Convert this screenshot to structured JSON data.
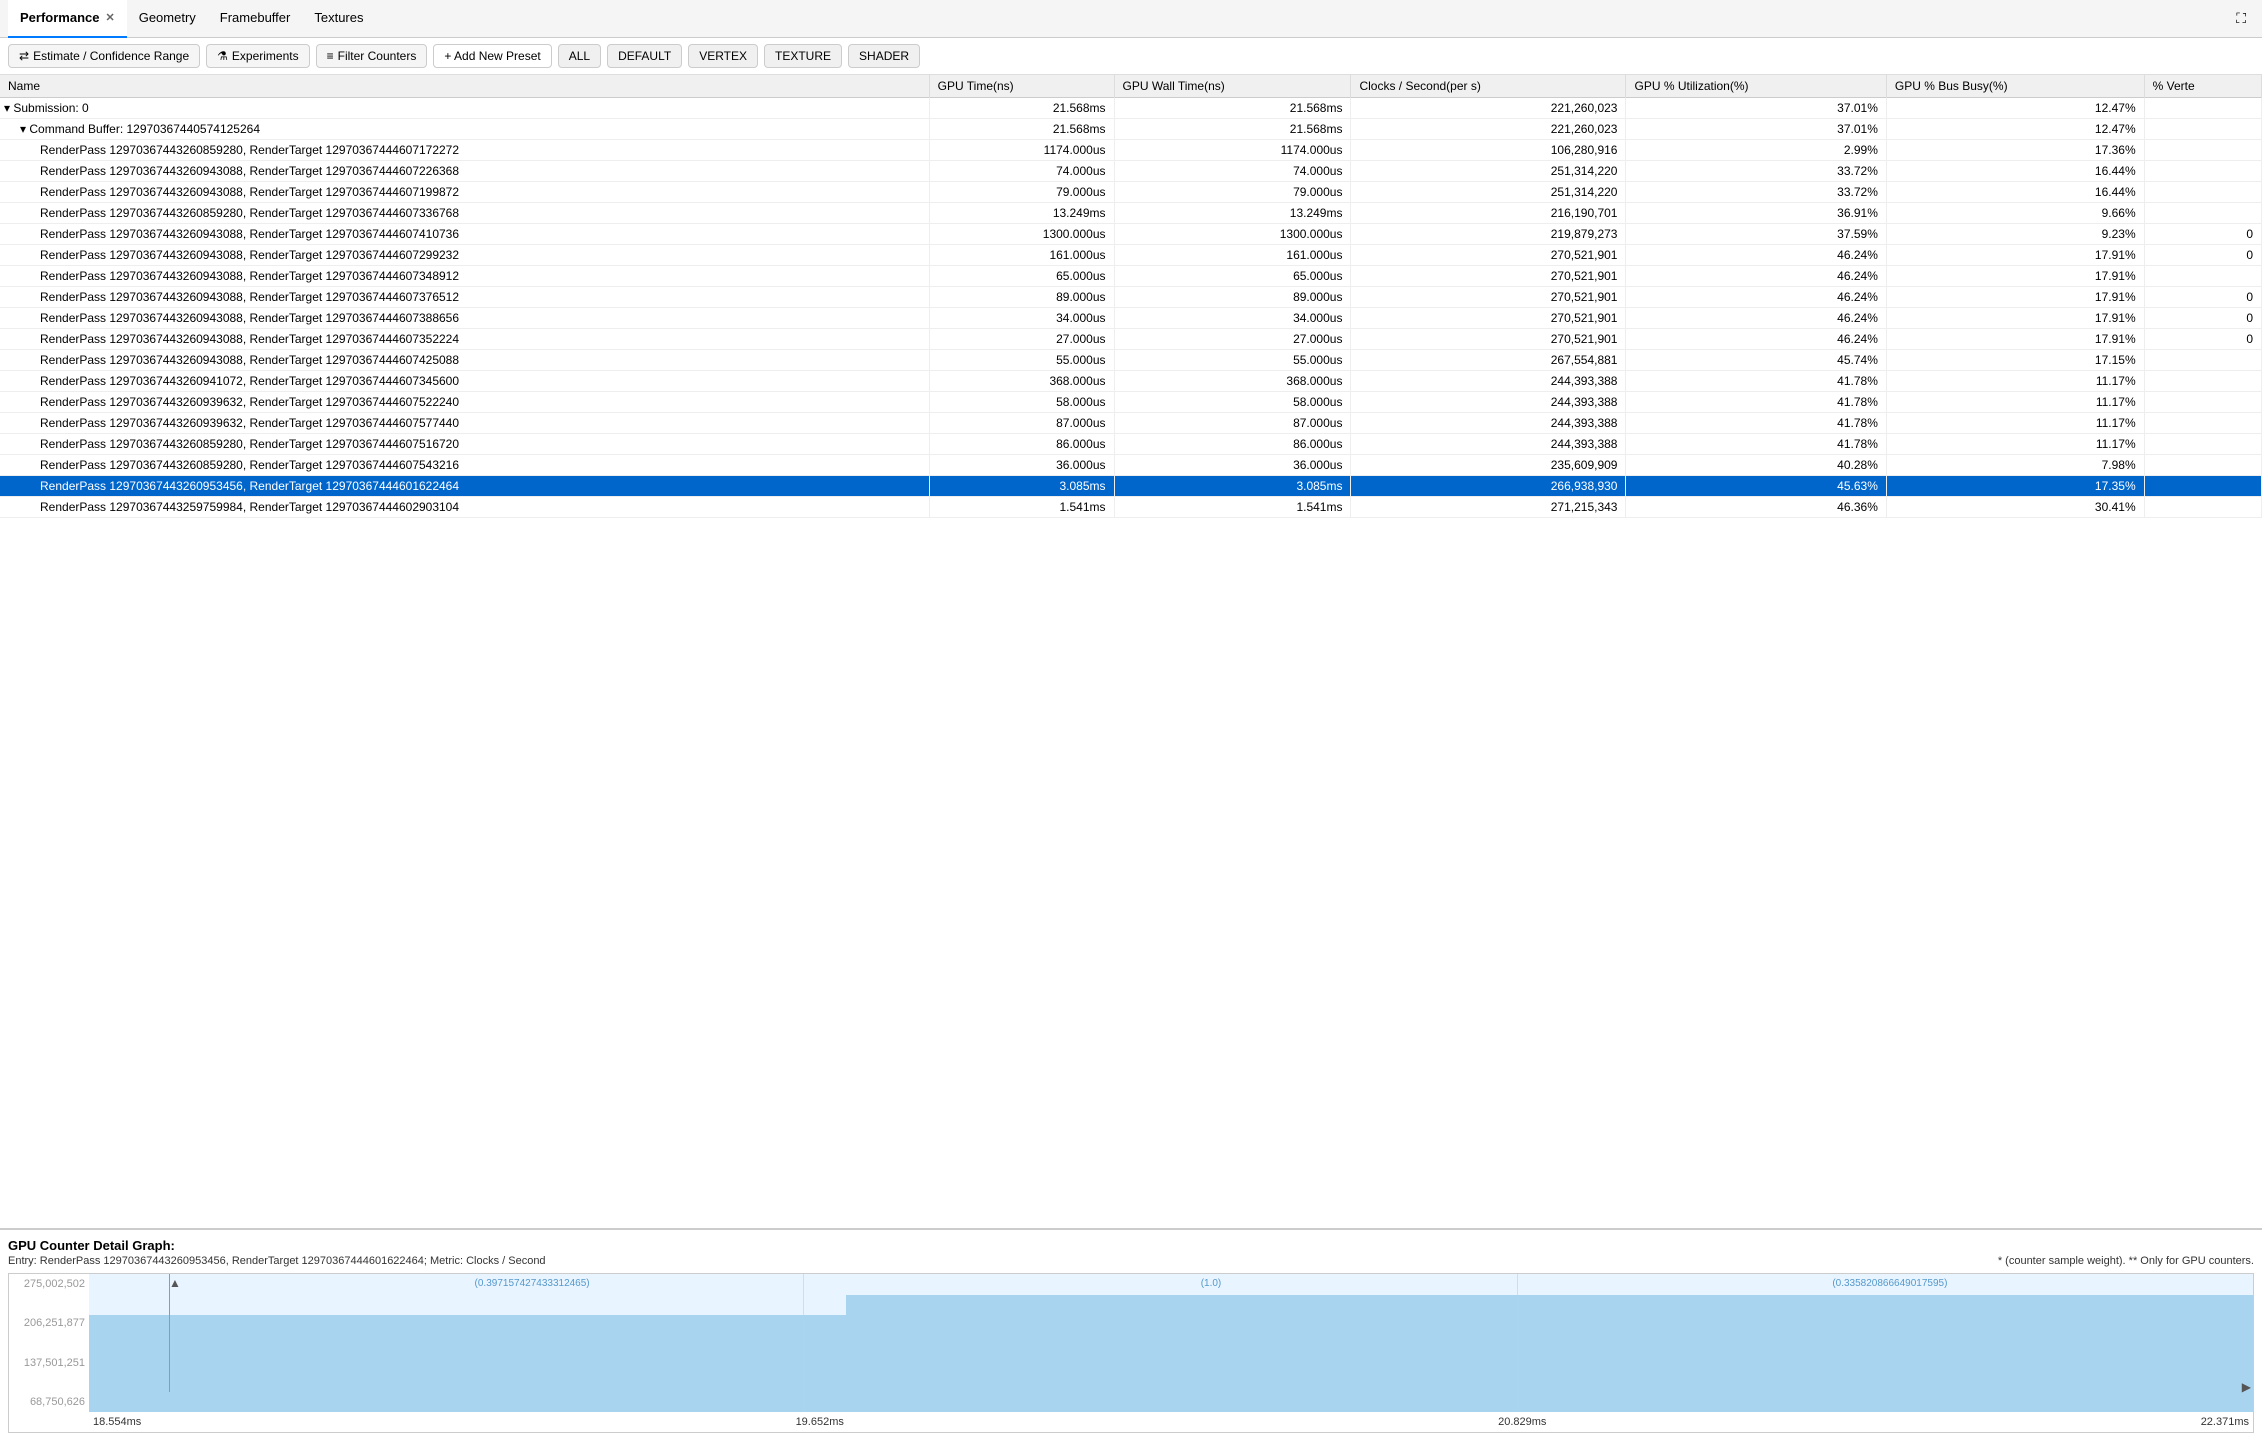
{
  "tabs": [
    {
      "id": "performance",
      "label": "Performance",
      "active": true,
      "closeable": true
    },
    {
      "id": "geometry",
      "label": "Geometry",
      "active": false,
      "closeable": false
    },
    {
      "id": "framebuffer",
      "label": "Framebuffer",
      "active": false,
      "closeable": false
    },
    {
      "id": "textures",
      "label": "Textures",
      "active": false,
      "closeable": false
    }
  ],
  "toolbar": {
    "estimate_label": "Estimate / Confidence Range",
    "experiments_label": "Experiments",
    "filter_label": "Filter Counters",
    "add_preset_label": "+ Add New Preset",
    "tags": [
      "ALL",
      "DEFAULT",
      "VERTEX",
      "TEXTURE",
      "SHADER"
    ]
  },
  "table": {
    "headers": [
      "Name",
      "GPU Time(ns)",
      "GPU Wall Time(ns)",
      "Clocks / Second(per s)",
      "GPU % Utilization(%)",
      "GPU % Bus Busy(%)",
      "% Verte"
    ],
    "rows": [
      {
        "indent": 0,
        "expand": true,
        "name": "Submission: 0",
        "gpu_time": "21.568ms",
        "gpu_wall": "21.568ms",
        "clocks": "221,260,023",
        "gpu_util": "37.01%",
        "gpu_bus": "12.47%",
        "verte": "",
        "selected": false
      },
      {
        "indent": 1,
        "expand": true,
        "name": "Command Buffer: 12970367440574125264",
        "gpu_time": "21.568ms",
        "gpu_wall": "21.568ms",
        "clocks": "221,260,023",
        "gpu_util": "37.01%",
        "gpu_bus": "12.47%",
        "verte": "",
        "selected": false
      },
      {
        "indent": 2,
        "expand": false,
        "name": "RenderPass 12970367443260859280, RenderTarget 12970367444607172272",
        "gpu_time": "1174.000us",
        "gpu_wall": "1174.000us",
        "clocks": "106,280,916",
        "gpu_util": "2.99%",
        "gpu_bus": "17.36%",
        "verte": "",
        "selected": false
      },
      {
        "indent": 2,
        "expand": false,
        "name": "RenderPass 12970367443260943088, RenderTarget 12970367444607226368",
        "gpu_time": "74.000us",
        "gpu_wall": "74.000us",
        "clocks": "251,314,220",
        "gpu_util": "33.72%",
        "gpu_bus": "16.44%",
        "verte": "",
        "selected": false
      },
      {
        "indent": 2,
        "expand": false,
        "name": "RenderPass 12970367443260943088, RenderTarget 12970367444607199872",
        "gpu_time": "79.000us",
        "gpu_wall": "79.000us",
        "clocks": "251,314,220",
        "gpu_util": "33.72%",
        "gpu_bus": "16.44%",
        "verte": "",
        "selected": false
      },
      {
        "indent": 2,
        "expand": false,
        "name": "RenderPass 12970367443260859280, RenderTarget 12970367444607336768",
        "gpu_time": "13.249ms",
        "gpu_wall": "13.249ms",
        "clocks": "216,190,701",
        "gpu_util": "36.91%",
        "gpu_bus": "9.66%",
        "verte": "",
        "selected": false
      },
      {
        "indent": 2,
        "expand": false,
        "name": "RenderPass 12970367443260943088, RenderTarget 12970367444607410736",
        "gpu_time": "1300.000us",
        "gpu_wall": "1300.000us",
        "clocks": "219,879,273",
        "gpu_util": "37.59%",
        "gpu_bus": "9.23%",
        "verte": "0",
        "selected": false
      },
      {
        "indent": 2,
        "expand": false,
        "name": "RenderPass 12970367443260943088, RenderTarget 12970367444607299232",
        "gpu_time": "161.000us",
        "gpu_wall": "161.000us",
        "clocks": "270,521,901",
        "gpu_util": "46.24%",
        "gpu_bus": "17.91%",
        "verte": "0",
        "selected": false
      },
      {
        "indent": 2,
        "expand": false,
        "name": "RenderPass 12970367443260943088, RenderTarget 12970367444607348912",
        "gpu_time": "65.000us",
        "gpu_wall": "65.000us",
        "clocks": "270,521,901",
        "gpu_util": "46.24%",
        "gpu_bus": "17.91%",
        "verte": "",
        "selected": false
      },
      {
        "indent": 2,
        "expand": false,
        "name": "RenderPass 12970367443260943088, RenderTarget 12970367444607376512",
        "gpu_time": "89.000us",
        "gpu_wall": "89.000us",
        "clocks": "270,521,901",
        "gpu_util": "46.24%",
        "gpu_bus": "17.91%",
        "verte": "0",
        "selected": false
      },
      {
        "indent": 2,
        "expand": false,
        "name": "RenderPass 12970367443260943088, RenderTarget 12970367444607388656",
        "gpu_time": "34.000us",
        "gpu_wall": "34.000us",
        "clocks": "270,521,901",
        "gpu_util": "46.24%",
        "gpu_bus": "17.91%",
        "verte": "0",
        "selected": false
      },
      {
        "indent": 2,
        "expand": false,
        "name": "RenderPass 12970367443260943088, RenderTarget 12970367444607352224",
        "gpu_time": "27.000us",
        "gpu_wall": "27.000us",
        "clocks": "270,521,901",
        "gpu_util": "46.24%",
        "gpu_bus": "17.91%",
        "verte": "0",
        "selected": false
      },
      {
        "indent": 2,
        "expand": false,
        "name": "RenderPass 12970367443260943088, RenderTarget 12970367444607425088",
        "gpu_time": "55.000us",
        "gpu_wall": "55.000us",
        "clocks": "267,554,881",
        "gpu_util": "45.74%",
        "gpu_bus": "17.15%",
        "verte": "",
        "selected": false
      },
      {
        "indent": 2,
        "expand": false,
        "name": "RenderPass 12970367443260941072, RenderTarget 12970367444607345600",
        "gpu_time": "368.000us",
        "gpu_wall": "368.000us",
        "clocks": "244,393,388",
        "gpu_util": "41.78%",
        "gpu_bus": "11.17%",
        "verte": "",
        "selected": false
      },
      {
        "indent": 2,
        "expand": false,
        "name": "RenderPass 12970367443260939632, RenderTarget 12970367444607522240",
        "gpu_time": "58.000us",
        "gpu_wall": "58.000us",
        "clocks": "244,393,388",
        "gpu_util": "41.78%",
        "gpu_bus": "11.17%",
        "verte": "",
        "selected": false
      },
      {
        "indent": 2,
        "expand": false,
        "name": "RenderPass 12970367443260939632, RenderTarget 12970367444607577440",
        "gpu_time": "87.000us",
        "gpu_wall": "87.000us",
        "clocks": "244,393,388",
        "gpu_util": "41.78%",
        "gpu_bus": "11.17%",
        "verte": "",
        "selected": false
      },
      {
        "indent": 2,
        "expand": false,
        "name": "RenderPass 12970367443260859280, RenderTarget 12970367444607516720",
        "gpu_time": "86.000us",
        "gpu_wall": "86.000us",
        "clocks": "244,393,388",
        "gpu_util": "41.78%",
        "gpu_bus": "11.17%",
        "verte": "",
        "selected": false
      },
      {
        "indent": 2,
        "expand": false,
        "name": "RenderPass 12970367443260859280, RenderTarget 12970367444607543216",
        "gpu_time": "36.000us",
        "gpu_wall": "36.000us",
        "clocks": "235,609,909",
        "gpu_util": "40.28%",
        "gpu_bus": "7.98%",
        "verte": "",
        "selected": false
      },
      {
        "indent": 2,
        "expand": false,
        "name": "RenderPass 12970367443260953456, RenderTarget 12970367444601622464",
        "gpu_time": "3.085ms",
        "gpu_wall": "3.085ms",
        "clocks": "266,938,930",
        "gpu_util": "45.63%",
        "gpu_bus": "17.35%",
        "verte": "",
        "selected": true
      },
      {
        "indent": 2,
        "expand": false,
        "name": "RenderPass 12970367443259759984, RenderTarget 12970367444602903104",
        "gpu_time": "1.541ms",
        "gpu_wall": "1.541ms",
        "clocks": "271,215,343",
        "gpu_util": "46.36%",
        "gpu_bus": "30.41%",
        "verte": "",
        "selected": false
      }
    ]
  },
  "graph": {
    "title": "GPU Counter Detail Graph:",
    "entry_label": "Entry: RenderPass 12970367443260953456, RenderTarget 12970367444601622464; Metric: Clocks / Second",
    "footnote": "* (counter sample weight). ** Only for GPU counters.",
    "y_labels": [
      "275,002,502",
      "206,251,877",
      "137,501,251",
      "68,750,626"
    ],
    "x_labels": [
      "18.554ms",
      "19.652ms",
      "20.829ms",
      "22.371ms"
    ],
    "annotations": [
      "(0.397157427433312465)",
      "(1.0)",
      "(0.335820866649017595)"
    ],
    "fill_height_pct": 70
  }
}
